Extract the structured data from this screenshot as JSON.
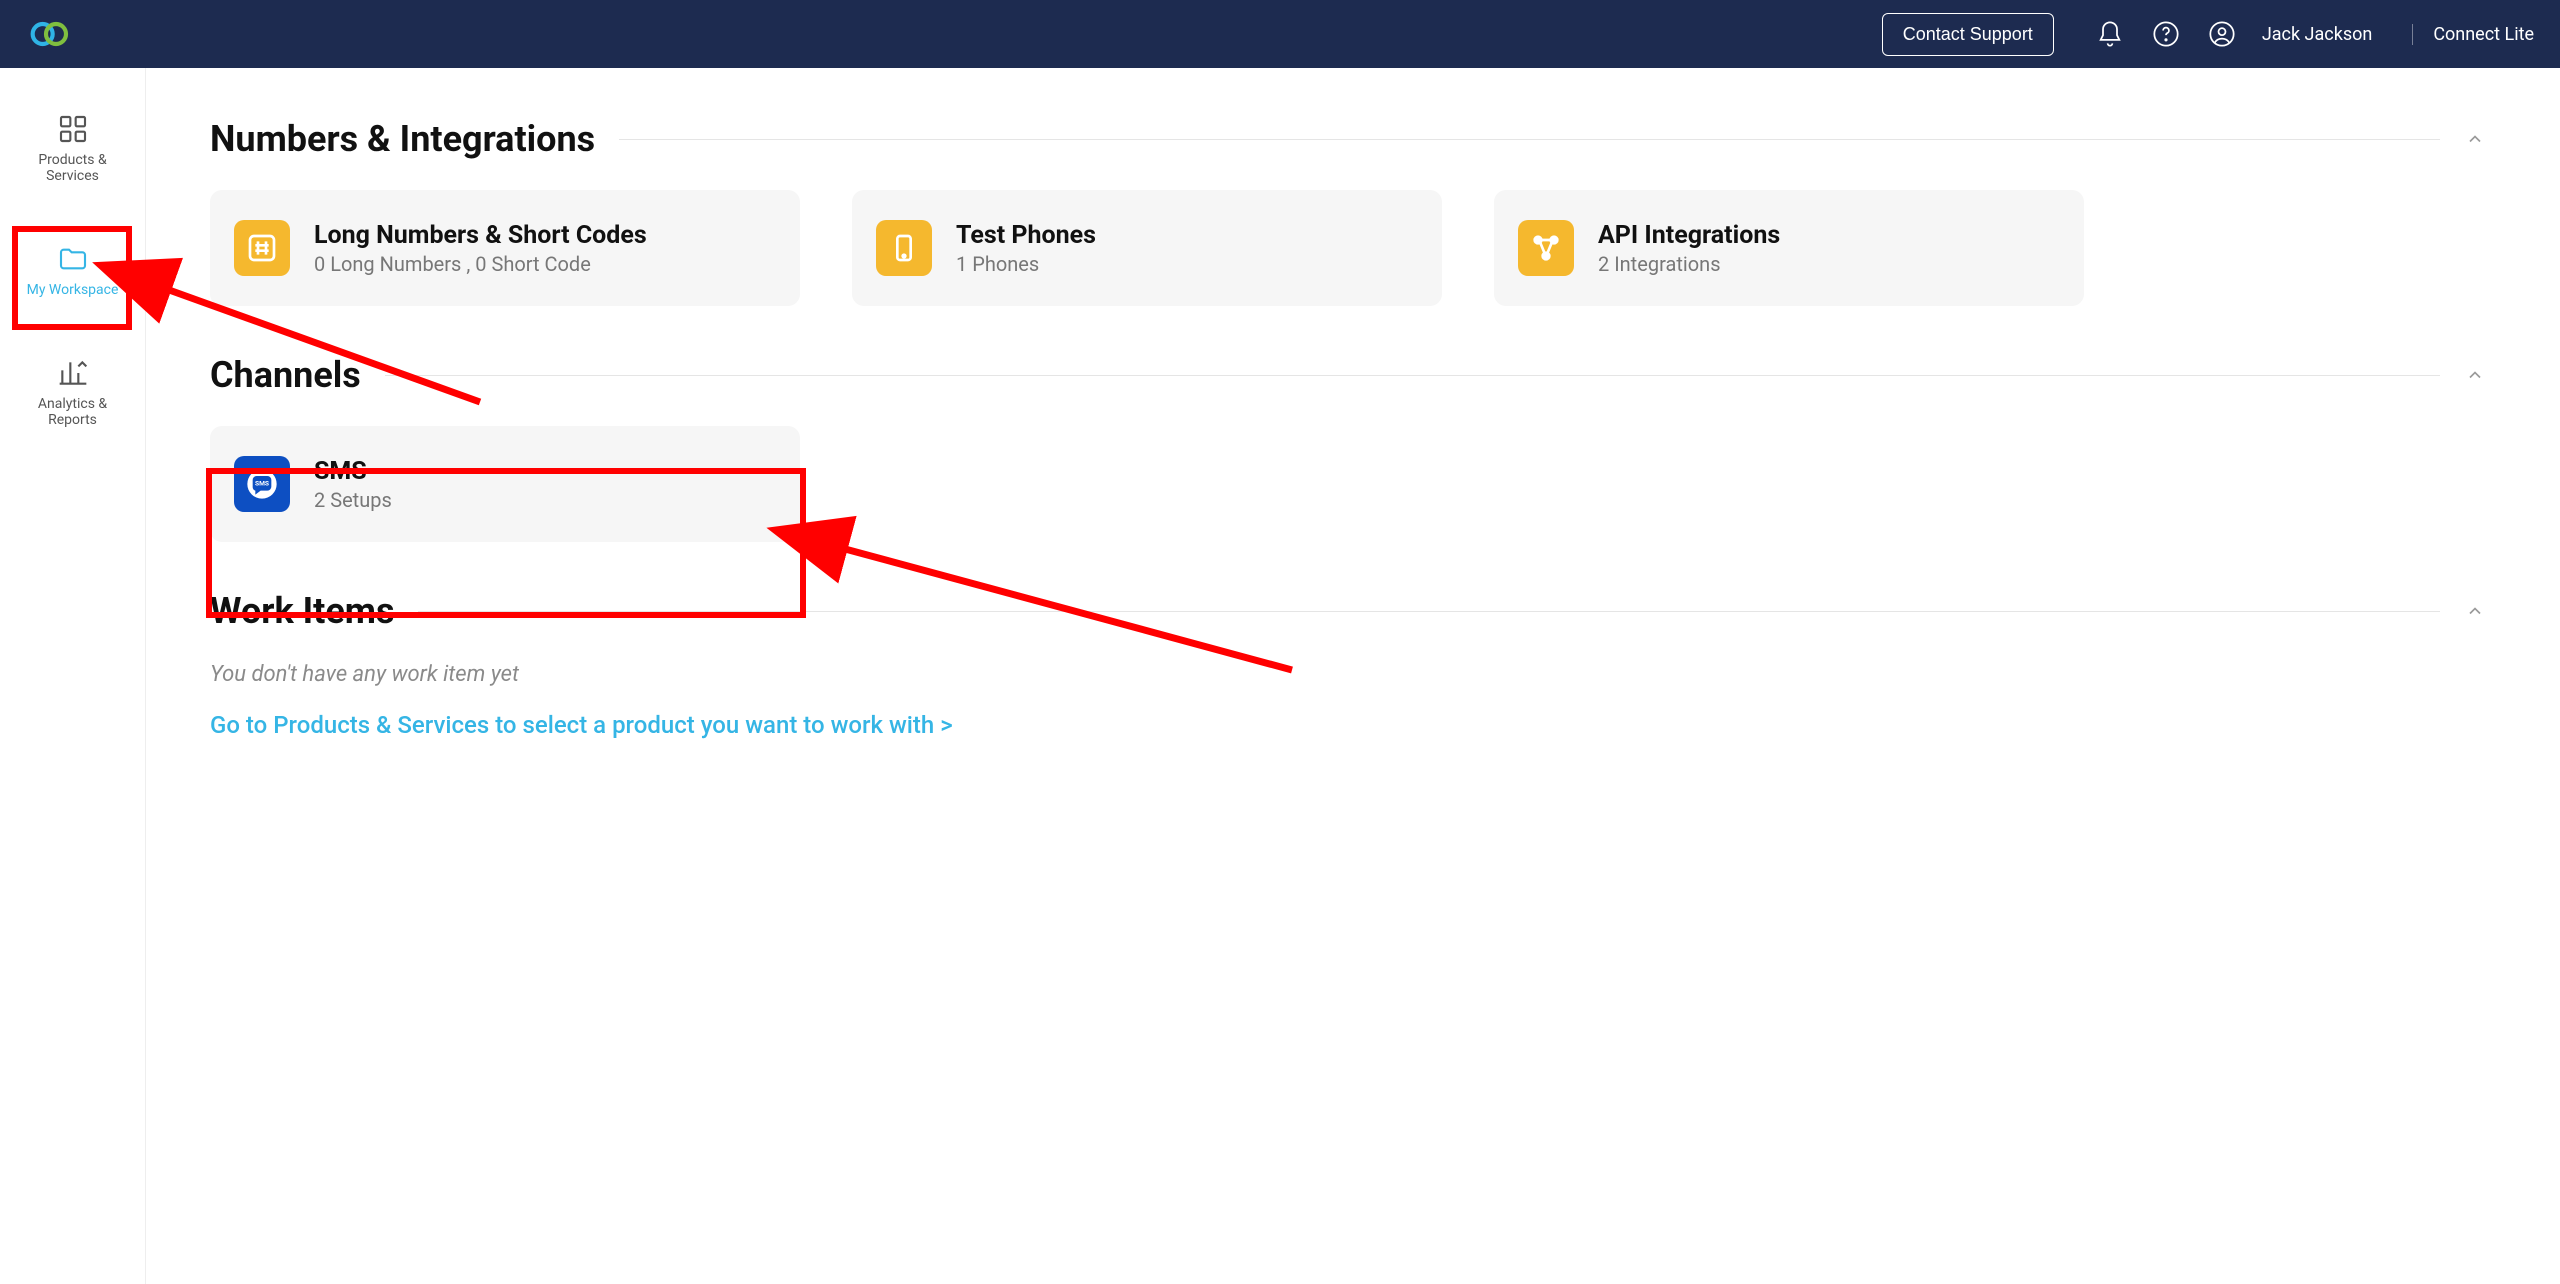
{
  "header": {
    "contact_button": "Contact Support",
    "user_name": "Jack Jackson",
    "plan": "Connect Lite"
  },
  "sidebar": {
    "items": [
      {
        "label": "Products & Services"
      },
      {
        "label": "My Workspace"
      },
      {
        "label": "Analytics & Reports"
      }
    ]
  },
  "sections": {
    "numbers": {
      "title": "Numbers & Integrations",
      "cards": [
        {
          "title": "Long Numbers & Short Codes",
          "sub": "0 Long Numbers ,  0 Short Code"
        },
        {
          "title": "Test Phones",
          "sub": "1 Phones"
        },
        {
          "title": "API Integrations",
          "sub": "2 Integrations"
        }
      ]
    },
    "channels": {
      "title": "Channels",
      "cards": [
        {
          "title": "SMS",
          "sub": "2 Setups"
        }
      ]
    },
    "work": {
      "title": "Work Items",
      "empty": "You don't have any work item yet",
      "link": "Go to Products & Services to select a product you want to work with >"
    }
  }
}
